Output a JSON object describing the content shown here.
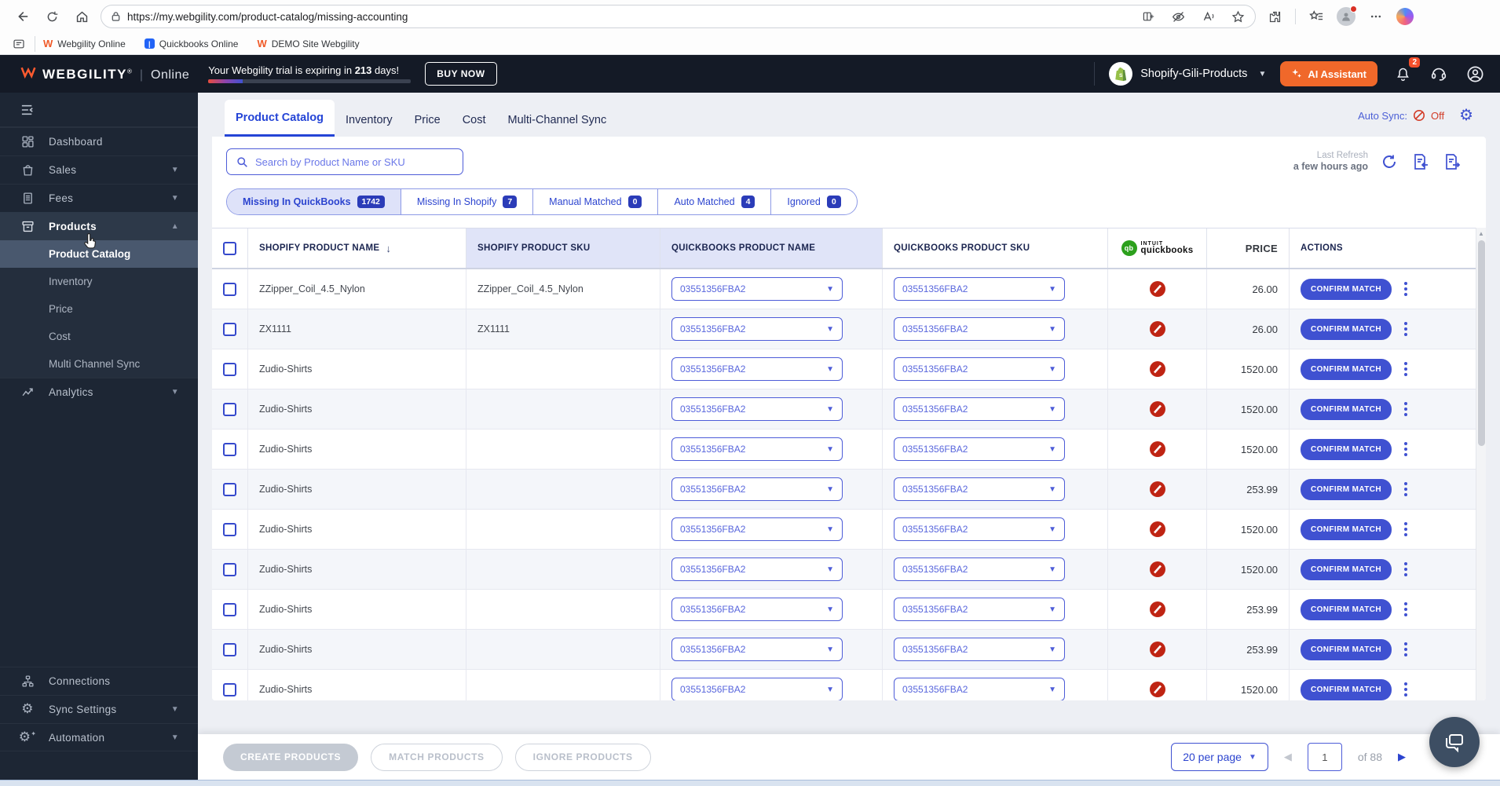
{
  "browser": {
    "url": "https://my.webgility.com/product-catalog/missing-accounting",
    "bookmarks": [
      {
        "label": "Webgility Online"
      },
      {
        "label": "Quickbooks Online"
      },
      {
        "label": "DEMO Site Webgility"
      }
    ]
  },
  "app_header": {
    "brand": "WEBGILITY",
    "brand_reg": "®",
    "pipe": "|",
    "mode": "Online",
    "trial_prefix": "Your Webgility trial is expiring in",
    "trial_days": "213",
    "trial_suffix": "days!",
    "buy_now": "BUY NOW",
    "store_name": "Shopify-Gili-Products",
    "ai_assistant": "AI Assistant",
    "bell_badge": "2"
  },
  "sidebar": {
    "items": [
      {
        "label": "Dashboard"
      },
      {
        "label": "Sales"
      },
      {
        "label": "Fees"
      },
      {
        "label": "Products",
        "active": true
      },
      {
        "label": "Product Catalog",
        "active": true
      },
      {
        "label": "Inventory"
      },
      {
        "label": "Price"
      },
      {
        "label": "Cost"
      },
      {
        "label": "Multi Channel Sync"
      },
      {
        "label": "Analytics"
      },
      {
        "label": "Connections"
      },
      {
        "label": "Sync Settings"
      },
      {
        "label": "Automation"
      }
    ]
  },
  "tabs": [
    {
      "label": "Product Catalog",
      "active": true
    },
    {
      "label": "Inventory"
    },
    {
      "label": "Price"
    },
    {
      "label": "Cost"
    },
    {
      "label": "Multi-Channel Sync"
    }
  ],
  "toolbar": {
    "autosync_label": "Auto Sync:",
    "autosync_state": "Off",
    "search_placeholder": "Search by Product Name or SKU",
    "last_refresh_label": "Last Refresh",
    "last_refresh_value": "a few hours ago"
  },
  "filters": [
    {
      "label": "Missing In QuickBooks",
      "count": "1742",
      "active": true
    },
    {
      "label": "Missing In Shopify",
      "count": "7"
    },
    {
      "label": "Manual Matched",
      "count": "0"
    },
    {
      "label": "Auto Matched",
      "count": "4"
    },
    {
      "label": "Ignored",
      "count": "0"
    }
  ],
  "table": {
    "headers": {
      "shopify_name": "SHOPIFY PRODUCT NAME",
      "shopify_sku": "SHOPIFY PRODUCT SKU",
      "qb_name": "QUICKBOOKS PRODUCT NAME",
      "qb_sku": "QUICKBOOKS PRODUCT SKU",
      "qb_monogram": "qb",
      "qb_logo_top": "intuit",
      "qb_logo_bottom": "quickbooks",
      "price": "PRICE",
      "actions": "ACTIONS"
    },
    "rows": [
      {
        "name": "ZZipper_Coil_4.5_Nylon",
        "sku": "ZZipper_Coil_4.5_Nylon",
        "qb_name": "03551356FBA2",
        "qb_sku": "03551356FBA2",
        "price": "26.00",
        "action": "CONFIRM MATCH"
      },
      {
        "name": "ZX1111",
        "sku": "ZX1111",
        "qb_name": "03551356FBA2",
        "qb_sku": "03551356FBA2",
        "price": "26.00",
        "action": "CONFIRM MATCH"
      },
      {
        "name": "Zudio-Shirts",
        "sku": "",
        "qb_name": "03551356FBA2",
        "qb_sku": "03551356FBA2",
        "price": "1520.00",
        "action": "CONFIRM MATCH"
      },
      {
        "name": "Zudio-Shirts",
        "sku": "",
        "qb_name": "03551356FBA2",
        "qb_sku": "03551356FBA2",
        "price": "1520.00",
        "action": "CONFIRM MATCH"
      },
      {
        "name": "Zudio-Shirts",
        "sku": "",
        "qb_name": "03551356FBA2",
        "qb_sku": "03551356FBA2",
        "price": "1520.00",
        "action": "CONFIRM MATCH"
      },
      {
        "name": "Zudio-Shirts",
        "sku": "",
        "qb_name": "03551356FBA2",
        "qb_sku": "03551356FBA2",
        "price": "253.99",
        "action": "CONFIRM MATCH"
      },
      {
        "name": "Zudio-Shirts",
        "sku": "",
        "qb_name": "03551356FBA2",
        "qb_sku": "03551356FBA2",
        "price": "1520.00",
        "action": "CONFIRM MATCH"
      },
      {
        "name": "Zudio-Shirts",
        "sku": "",
        "qb_name": "03551356FBA2",
        "qb_sku": "03551356FBA2",
        "price": "1520.00",
        "action": "CONFIRM MATCH"
      },
      {
        "name": "Zudio-Shirts",
        "sku": "",
        "qb_name": "03551356FBA2",
        "qb_sku": "03551356FBA2",
        "price": "253.99",
        "action": "CONFIRM MATCH"
      },
      {
        "name": "Zudio-Shirts",
        "sku": "",
        "qb_name": "03551356FBA2",
        "qb_sku": "03551356FBA2",
        "price": "253.99",
        "action": "CONFIRM MATCH"
      },
      {
        "name": "Zudio-Shirts",
        "sku": "",
        "qb_name": "03551356FBA2",
        "qb_sku": "03551356FBA2",
        "price": "1520.00",
        "action": "CONFIRM MATCH"
      }
    ]
  },
  "footer": {
    "buttons": [
      {
        "label": "CREATE PRODUCTS"
      },
      {
        "label": "MATCH PRODUCTS"
      },
      {
        "label": "IGNORE PRODUCTS"
      }
    ],
    "per_page": "20 per page",
    "page_value": "1",
    "page_total": "of 88"
  }
}
